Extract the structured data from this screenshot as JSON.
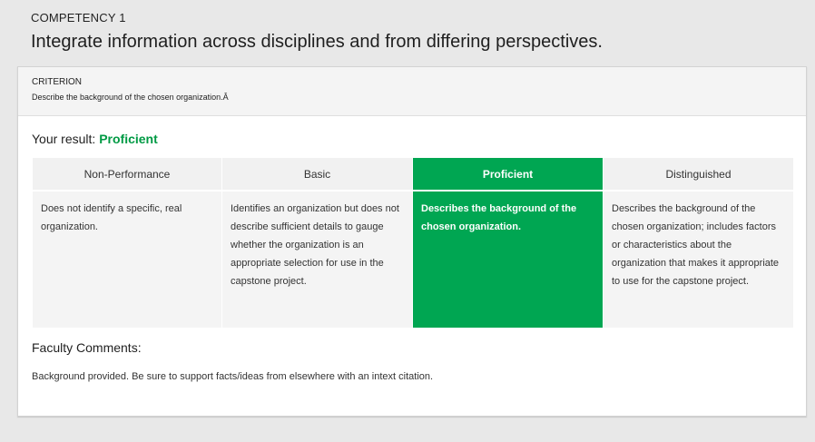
{
  "competency": {
    "kicker": "COMPETENCY 1",
    "title": "Integrate information across disciplines and from differing perspectives."
  },
  "criterion": {
    "kicker": "CRITERION",
    "text": "Describe the background of the chosen organization.Â"
  },
  "result": {
    "label": "Your result: ",
    "value": "Proficient"
  },
  "rubric": {
    "selected_index": 2,
    "columns": [
      {
        "heading": "Non-Performance",
        "description": "Does not identify a specific, real organization."
      },
      {
        "heading": "Basic",
        "description": "Identifies an organization but does not describe sufficient details to gauge whether the organization is an appropriate selection for use in the capstone project."
      },
      {
        "heading": "Proficient",
        "description": "Describes the background of the chosen organization."
      },
      {
        "heading": "Distinguished",
        "description": "Describes the background of the chosen organization; includes factors or characteristics about the organization that makes it appropriate to use for the capstone project."
      }
    ]
  },
  "faculty_comments": {
    "title": "Faculty Comments:",
    "text": "Background provided. Be sure to support facts/ideas from elsewhere with an intext citation."
  },
  "colors": {
    "accent": "#00a652",
    "page_background": "#e8e8e8",
    "cell_background": "#f4f4f4"
  }
}
